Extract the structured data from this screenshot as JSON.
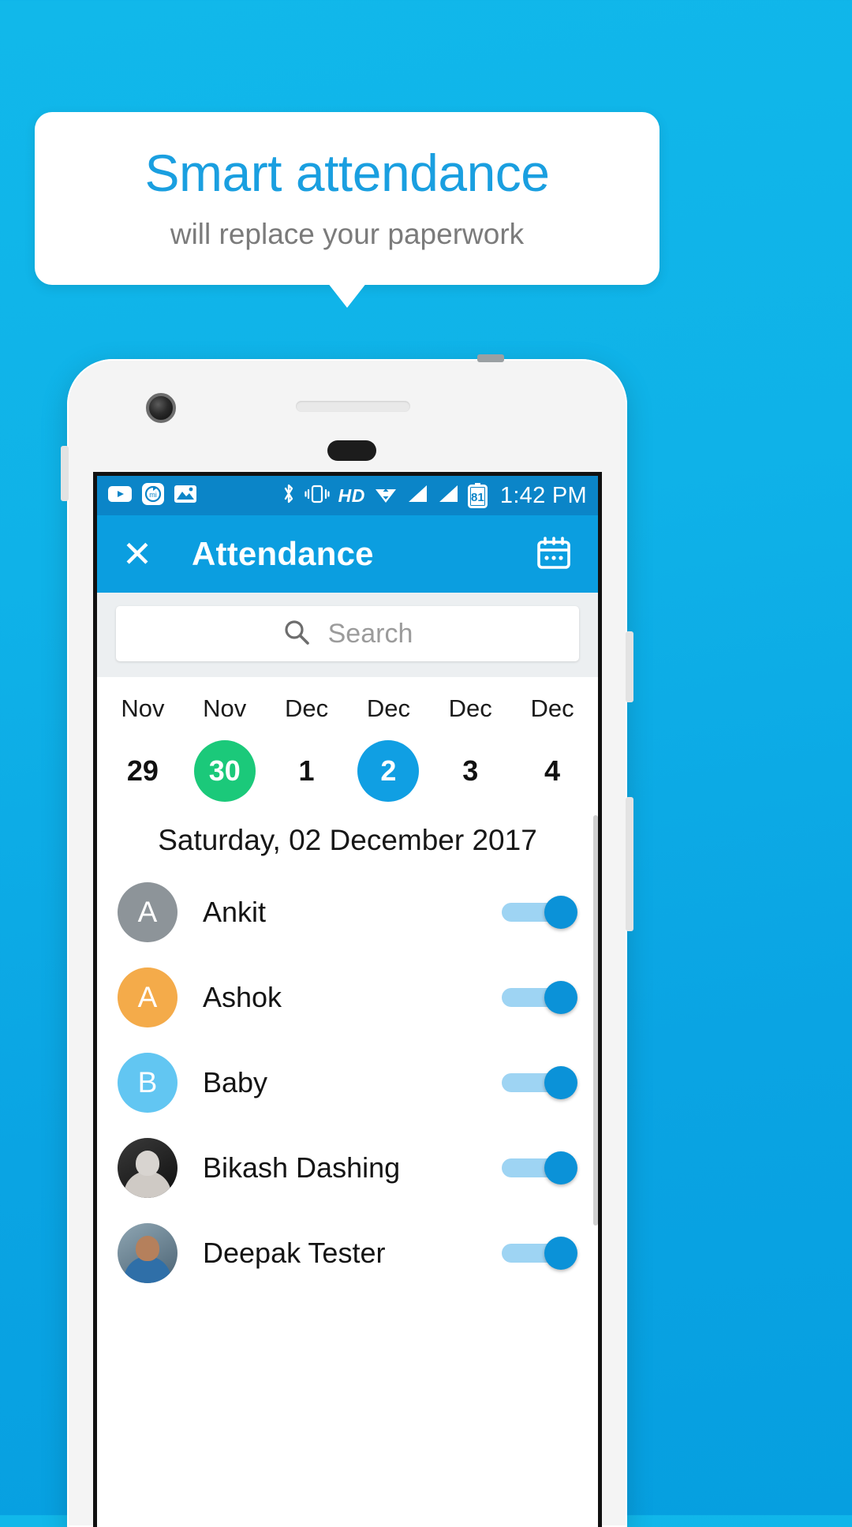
{
  "callout": {
    "title": "Smart attendance",
    "subtitle": "will replace your paperwork",
    "title_color": "#1a9fe0",
    "subtitle_color": "#7b7b7b"
  },
  "background_color": "#0fb2e8",
  "status_bar": {
    "time": "1:42 PM",
    "battery_level": "81",
    "hd_label": "HD",
    "left_icons": [
      "youtube-play-icon",
      "mi-sync-icon",
      "gallery-image-icon"
    ],
    "right_icons": [
      "bluetooth-icon",
      "vibrate-icon",
      "hd-icon",
      "wifi-icon",
      "signal-bars-1-icon",
      "signal-bars-2-icon",
      "battery-icon"
    ],
    "background_color": "#0b85c8"
  },
  "app_bar": {
    "close_label": "✕",
    "title": "Attendance",
    "calendar_icon": "calendar-icon",
    "background_color": "#0b9ee0"
  },
  "search": {
    "placeholder": "Search",
    "value": "",
    "icon": "search-icon"
  },
  "date_strip": [
    {
      "month": "Nov",
      "day": "29",
      "state": "normal"
    },
    {
      "month": "Nov",
      "day": "30",
      "state": "today"
    },
    {
      "month": "Dec",
      "day": "1",
      "state": "normal"
    },
    {
      "month": "Dec",
      "day": "2",
      "state": "selected"
    },
    {
      "month": "Dec",
      "day": "3",
      "state": "normal"
    },
    {
      "month": "Dec",
      "day": "4",
      "state": "normal"
    }
  ],
  "selected_date_label": "Saturday, 02 December 2017",
  "colors": {
    "today_green": "#1bc97a",
    "selected_blue": "#109fe3",
    "toggle_knob": "#0b92d8",
    "toggle_track": "#9ed4f3"
  },
  "people": [
    {
      "name": "Ankit",
      "initial": "A",
      "avatar_type": "initial",
      "avatar_color": "#8d9499",
      "present": true
    },
    {
      "name": "Ashok",
      "initial": "A",
      "avatar_type": "initial",
      "avatar_color": "#f4ab4a",
      "present": true
    },
    {
      "name": "Baby",
      "initial": "B",
      "avatar_type": "initial",
      "avatar_color": "#62c6f2",
      "present": true
    },
    {
      "name": "Bikash Dashing",
      "initial": "",
      "avatar_type": "photo-a",
      "avatar_color": "#1d1d1d",
      "present": true
    },
    {
      "name": "Deepak Tester",
      "initial": "",
      "avatar_type": "photo-b",
      "avatar_color": "#6e8896",
      "present": true
    }
  ]
}
